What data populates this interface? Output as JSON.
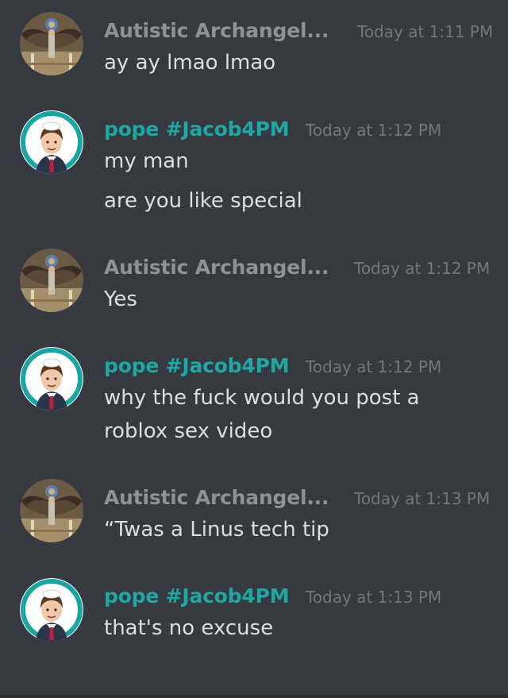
{
  "messages": [
    {
      "author": "Autistic Archangel...",
      "timestamp": "Today at 1:11 PM",
      "avatar": "archangel-avatar",
      "lines": [
        "ay ay lmao lmao"
      ]
    },
    {
      "author": "pope #Jacob4PM",
      "timestamp": "Today at 1:12 PM",
      "avatar": "pope-avatar",
      "lines": [
        "my man",
        "are you like special"
      ]
    },
    {
      "author": "Autistic Archangel...",
      "timestamp": "Today at 1:12 PM",
      "avatar": "archangel-avatar",
      "lines": [
        "Yes"
      ]
    },
    {
      "author": "pope #Jacob4PM",
      "timestamp": "Today at 1:12 PM",
      "avatar": "pope-avatar",
      "lines": [
        "why the fuck would you post a",
        "roblox sex video"
      ]
    },
    {
      "author": "Autistic Archangel...",
      "timestamp": "Today at 1:13 PM",
      "avatar": "archangel-avatar",
      "lines": [
        "“Twas a Linus tech tip"
      ]
    },
    {
      "author": "pope #Jacob4PM",
      "timestamp": "Today at 1:13 PM",
      "avatar": "pope-avatar",
      "lines": [
        "that's no excuse"
      ]
    }
  ],
  "colors": {
    "background": "#36393f",
    "author_archangel": "#8e9297",
    "author_pope": "#1fa7a4",
    "timestamp": "#72767d",
    "message_text": "#dcddde"
  }
}
